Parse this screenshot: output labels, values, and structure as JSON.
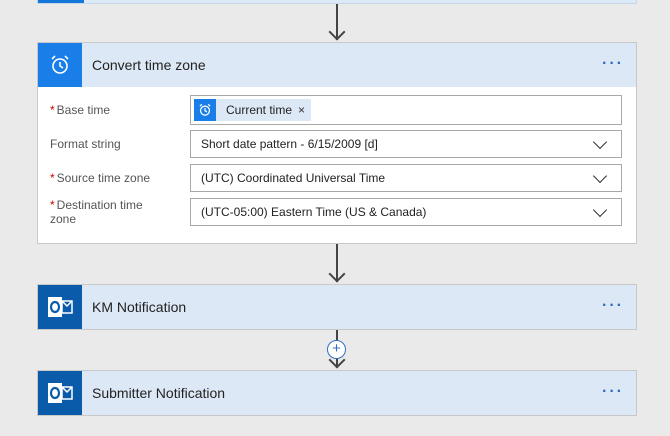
{
  "convert_card": {
    "title": "Convert time zone",
    "more_label": "···",
    "icon": "alarm-clock-icon",
    "fields": {
      "base_time": {
        "label": "Base time",
        "required_marker": "*",
        "token_label": "Current time",
        "token_remove": "×"
      },
      "format_string": {
        "label": "Format string",
        "value": "Short date pattern - 6/15/2009 [d]"
      },
      "source_time_zone": {
        "label": "Source time zone",
        "required_marker": "*",
        "value": "(UTC) Coordinated Universal Time"
      },
      "destination_time_zone": {
        "label": "Destination time zone",
        "required_marker": "*",
        "value": "(UTC-05:00) Eastern Time (US & Canada)"
      }
    }
  },
  "km_card": {
    "title": "KM Notification",
    "more_label": "···",
    "icon": "outlook-icon"
  },
  "submitter_card": {
    "title": "Submitter Notification",
    "more_label": "···",
    "icon": "outlook-icon"
  },
  "insert_step": {
    "label": "+"
  },
  "colors": {
    "accent": "#1a7ee8",
    "outlook": "#0a5cab",
    "header_bg": "#dde8f6",
    "link": "#2f6fbd"
  }
}
